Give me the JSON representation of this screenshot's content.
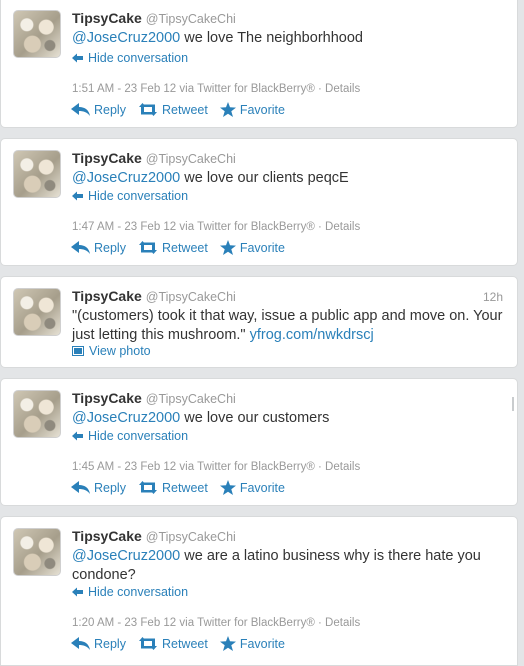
{
  "tweets": [
    {
      "name": "TipsyCake",
      "handle": "@TipsyCakeChi",
      "time": "",
      "mention": "@JoseCruz2000",
      "text": " we love The neighborhhood",
      "expand_label": "Hide conversation",
      "meta": "1:51 AM - 23 Feb 12 via Twitter for BlackBerry® · Details",
      "reply": "Reply",
      "retweet": "Retweet",
      "favorite": "Favorite"
    },
    {
      "name": "TipsyCake",
      "handle": "@TipsyCakeChi",
      "time": "",
      "mention": "@JoseCruz2000",
      "text": " we love our clients peqcE",
      "expand_label": "Hide conversation",
      "meta": "1:47 AM - 23 Feb 12 via Twitter for BlackBerry® · Details",
      "reply": "Reply",
      "retweet": "Retweet",
      "favorite": "Favorite"
    },
    {
      "name": "TipsyCake",
      "handle": "@TipsyCakeChi",
      "time": "12h",
      "mention": "",
      "text": "\"(customers) took it that way, issue a public app and move on. Your just letting this mushroom.\" ",
      "link": "yfrog.com/nwkdrscj",
      "expand_label": "View photo",
      "meta": "",
      "reply": "",
      "retweet": "",
      "favorite": ""
    },
    {
      "name": "TipsyCake",
      "handle": "@TipsyCakeChi",
      "time": "",
      "mention": "@JoseCruz2000",
      "text": " we love our customers",
      "expand_label": "Hide conversation",
      "meta": "1:45 AM - 23 Feb 12 via Twitter for BlackBerry® · Details",
      "reply": "Reply",
      "retweet": "Retweet",
      "favorite": "Favorite"
    },
    {
      "name": "TipsyCake",
      "handle": "@TipsyCakeChi",
      "time": "",
      "mention": "@JoseCruz2000",
      "text": " we are a latino business why is there hate you condone?",
      "expand_label": "Hide conversation",
      "meta": "1:20 AM - 23 Feb 12 via Twitter for BlackBerry® · Details",
      "reply": "Reply",
      "retweet": "Retweet",
      "favorite": "Favorite"
    }
  ],
  "colors": {
    "link": "#2a80b9",
    "muted": "#999999",
    "text": "#333333",
    "background": "#e3e5e7"
  },
  "icons": [
    "reply-arrow-icon",
    "retweet-icon",
    "favorite-star-icon",
    "back-arrow-icon",
    "photo-icon"
  ]
}
